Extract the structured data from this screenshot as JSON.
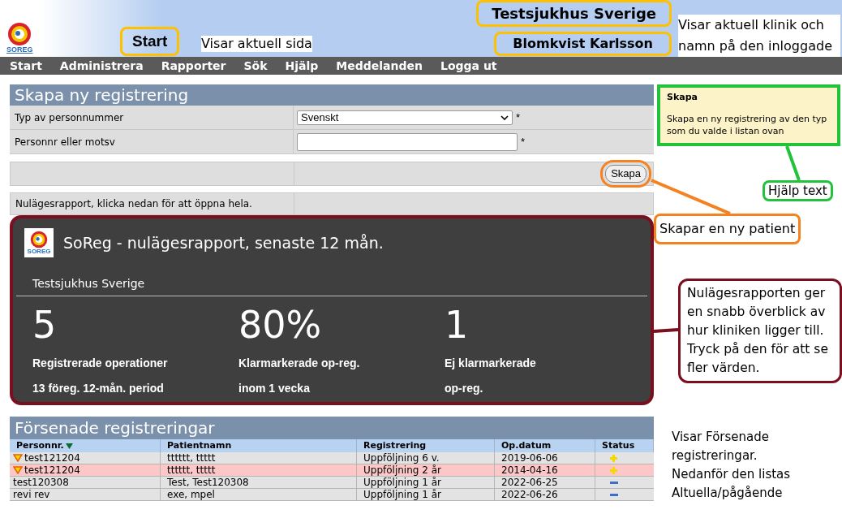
{
  "header": {
    "logo_text": "SOREG",
    "current_page": "Start",
    "clinic": "Testsjukhus Sverige",
    "user": "Blomkvist Karlsson"
  },
  "nav": [
    "Start",
    "Administrera",
    "Rapporter",
    "Sök",
    "Hjälp",
    "Meddelanden",
    "Logga ut"
  ],
  "form": {
    "title": "Skapa ny registrering",
    "fields": [
      {
        "kind": "select",
        "label": "Typ av personnummer",
        "value": "Svenskt",
        "required_mark": "*"
      },
      {
        "kind": "text",
        "label": "Personnr eller motsv",
        "required_mark": "*"
      }
    ],
    "button": "Skapa"
  },
  "report_link": "Nulägesrapport, klicka nedan för att öppna hela.",
  "report": {
    "logo_text": "SOREG",
    "title": "SoReg - nulägesrapport, senaste 12 mån.",
    "clinic": "Testsjukhus Sverige",
    "stats": [
      {
        "value": "5",
        "label": "Registrerade operationer",
        "sublabel": "13 föreg. 12-mån. period"
      },
      {
        "value": "80%",
        "label": "Klarmarkerade op-reg.",
        "sublabel": "inom 1 vecka"
      },
      {
        "value": "1",
        "label": "Ej klarmarkerade",
        "sublabel": "op-reg."
      }
    ]
  },
  "late": {
    "title": "Försenade registreringar",
    "columns": [
      "Personnr.",
      "Patientnamn",
      "Registrering",
      "Op.datum",
      "Status"
    ],
    "rows": [
      {
        "warning": true,
        "highlighted": false,
        "kind": "plus",
        "cells": [
          "test121204",
          "tttttt, ttttt",
          "Uppföljning 6 v.",
          "2019-06-06"
        ]
      },
      {
        "warning": true,
        "highlighted": true,
        "kind": "plus",
        "cells": [
          "test121204",
          "tttttt, ttttt",
          "Uppföljning 2 år",
          "2014-04-16"
        ]
      },
      {
        "warning": false,
        "highlighted": false,
        "kind": "minus",
        "cells": [
          "test120308",
          "Test, Test120308",
          "Uppföljning 1 år",
          "2022-06-25"
        ]
      },
      {
        "warning": false,
        "highlighted": false,
        "kind": "minus",
        "cells": [
          "revi rev",
          "exe, mpel",
          "Uppföljning 1 år",
          "2022-06-26"
        ]
      }
    ]
  },
  "help": {
    "title": "Skapa",
    "text": "Skapa en ny registrering av den typ som du valde i listan ovan"
  },
  "annotations": [
    {
      "kind": "page",
      "text": "Visar aktuell sida"
    },
    {
      "kind": "clinic",
      "text": "Visar aktuell klinik och namn på den inloggade"
    },
    {
      "kind": "help",
      "text": "Hjälp text",
      "color": "#22c33b"
    },
    {
      "kind": "create",
      "text": "Skapar en ny patient",
      "color": "#f58220"
    },
    {
      "kind": "report",
      "text": "Nulägesrapporten ger en snabb överblick av hur kliniken ligger till. Tryck på den för att se fler värden.",
      "color": "#7a0f1f"
    },
    {
      "kind": "late",
      "text": "Visar Försenade registreringar. Nedanför den listas Altuella/pågående"
    }
  ]
}
